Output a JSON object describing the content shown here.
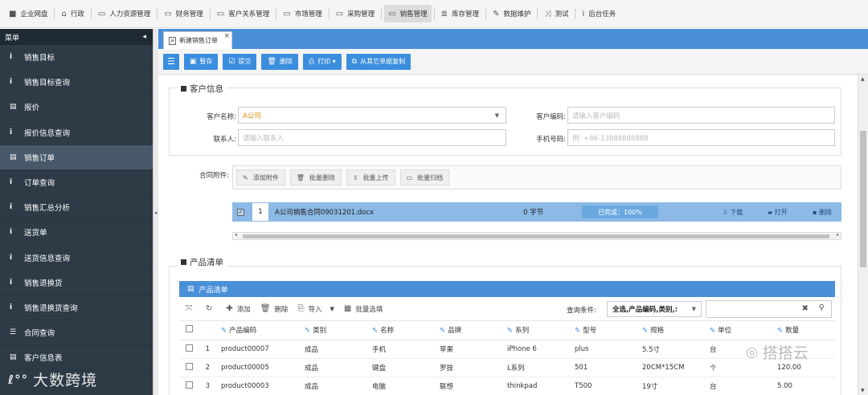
{
  "topnav": {
    "items": [
      {
        "label": "企业网盘",
        "icon": "folder-icon"
      },
      {
        "label": "行政",
        "icon": "bank-icon"
      },
      {
        "label": "人力资源管理",
        "icon": "folder-open-icon"
      },
      {
        "label": "财务管理",
        "icon": "folder-open-icon"
      },
      {
        "label": "客户关系管理",
        "icon": "folder-open-icon"
      },
      {
        "label": "市场管理",
        "icon": "folder-open-icon"
      },
      {
        "label": "采购管理",
        "icon": "folder-open-icon"
      },
      {
        "label": "销售管理",
        "icon": "folder-open-icon",
        "active": true
      },
      {
        "label": "库存管理",
        "icon": "database-icon"
      },
      {
        "label": "数据维护",
        "icon": "wrench-icon"
      },
      {
        "label": "测试",
        "icon": "shuffle-icon"
      },
      {
        "label": "后台任务",
        "icon": "info-icon"
      }
    ]
  },
  "sidebar": {
    "header": "菜单",
    "collapse_icon": "◂",
    "items": [
      {
        "label": "销售目标",
        "icon": "i"
      },
      {
        "label": "销售目标查询",
        "icon": "i"
      },
      {
        "label": "报价",
        "icon": "▤"
      },
      {
        "label": "报价信息查询",
        "icon": "i"
      },
      {
        "label": "销售订单",
        "icon": "▤",
        "active": true
      },
      {
        "label": "订单查询",
        "icon": "i"
      },
      {
        "label": "销售汇总分析",
        "icon": "i"
      },
      {
        "label": "送货单",
        "icon": "i"
      },
      {
        "label": "送货信息查询",
        "icon": "i"
      },
      {
        "label": "销售退换货",
        "icon": "i"
      },
      {
        "label": "销售退换货查询",
        "icon": "i"
      },
      {
        "label": "合同查询",
        "icon": "☰"
      },
      {
        "label": "客户信息表",
        "icon": "▤"
      }
    ],
    "logo_text": "大数跨境",
    "logo_mark": "ℓ°°"
  },
  "tab": {
    "label": "新建销售订单",
    "close": "×"
  },
  "toolbar": {
    "list_icon": "☰",
    "save": "暂存",
    "submit": "提交",
    "delete": "删除",
    "print": "打印 ▾",
    "copy": "从其它单据复制"
  },
  "customer": {
    "legend": "客户信息",
    "name_label": "客户名称:",
    "name_value": "A公司",
    "code_label": "客户编码:",
    "code_placeholder": "请输入客户编码",
    "contact_label": "联系人:",
    "contact_placeholder": "请输入联系人",
    "phone_label": "手机号码:",
    "phone_placeholder": "例: +86-13888888888"
  },
  "attachment": {
    "label": "合同附件:",
    "add": "添加附件",
    "batch_delete": "批量删除",
    "batch_upload": "批量上传",
    "batch_archive": "批量归档",
    "file": {
      "index": "1",
      "name": "A公司销售合同09031201.docx",
      "size": "0 字节",
      "progress_text": "已完成：100%",
      "progress": 1.0,
      "download": "下载",
      "open": "打开",
      "delete": "删除"
    }
  },
  "products": {
    "legend": "产品清单",
    "grid_title": "产品清单",
    "tools": {
      "add": "添加",
      "delete": "删除",
      "import": "导入",
      "batch_select": "批量选填"
    },
    "query_label": "查询条件:",
    "query_value": "全选,产品编码,类别,:",
    "columns": [
      "产品编码",
      "类别",
      "名称",
      "品牌",
      "系列",
      "型号",
      "规格",
      "单位",
      "数量"
    ],
    "rows": [
      {
        "n": "1",
        "code": "product00007",
        "category": "成品",
        "name": "手机",
        "brand": "苹果",
        "series": "iPhone 6",
        "model": "plus",
        "spec": "5.5寸",
        "unit": "台",
        "qty": ""
      },
      {
        "n": "2",
        "code": "product00005",
        "category": "成品",
        "name": "键盘",
        "brand": "罗技",
        "series": "L系列",
        "model": "501",
        "spec": "20CM*15CM",
        "unit": "个",
        "qty": "120.00"
      },
      {
        "n": "3",
        "code": "product00003",
        "category": "成品",
        "name": "电脑",
        "brand": "联想",
        "series": "thinkpad",
        "model": "T500",
        "spec": "19寸",
        "unit": "台",
        "qty": "5.00"
      }
    ]
  },
  "watermark": {
    "text": "搭搭云",
    "icon": "wechat-icon"
  }
}
